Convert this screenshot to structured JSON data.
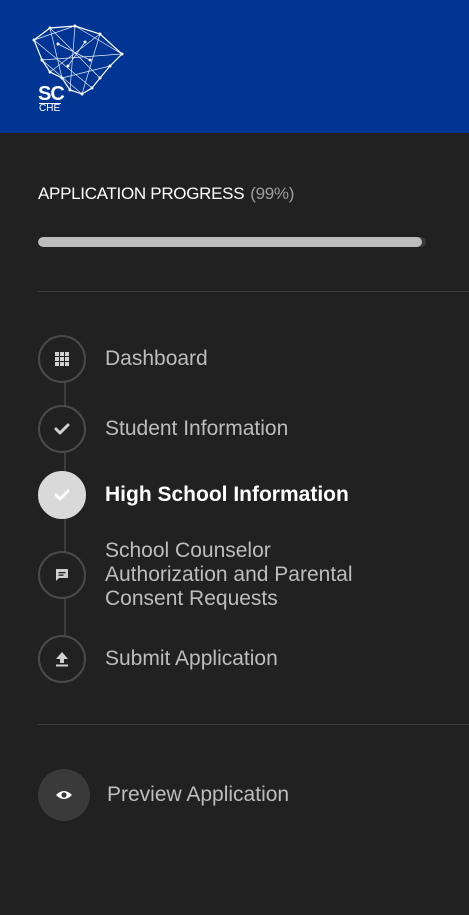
{
  "header": {
    "logo_text": "SC",
    "logo_subtext": "CHE",
    "background_color": "#003594"
  },
  "progress": {
    "title": "APPLICATION PROGRESS",
    "percent_text": "(99%)",
    "percent_value": 99
  },
  "steps": [
    {
      "label": "Dashboard",
      "icon": "grid-icon",
      "state": "default"
    },
    {
      "label": "Student Information",
      "icon": "check-icon",
      "state": "completed"
    },
    {
      "label": "High School Information",
      "icon": "check-icon",
      "state": "active"
    },
    {
      "label_lines": [
        "School Counselor",
        "Authorization and Parental",
        "Consent Requests"
      ],
      "icon": "message-icon",
      "state": "default"
    },
    {
      "label": "Submit Application",
      "icon": "upload-icon",
      "state": "default"
    }
  ],
  "preview": {
    "label": "Preview Application",
    "icon": "eye-icon"
  }
}
